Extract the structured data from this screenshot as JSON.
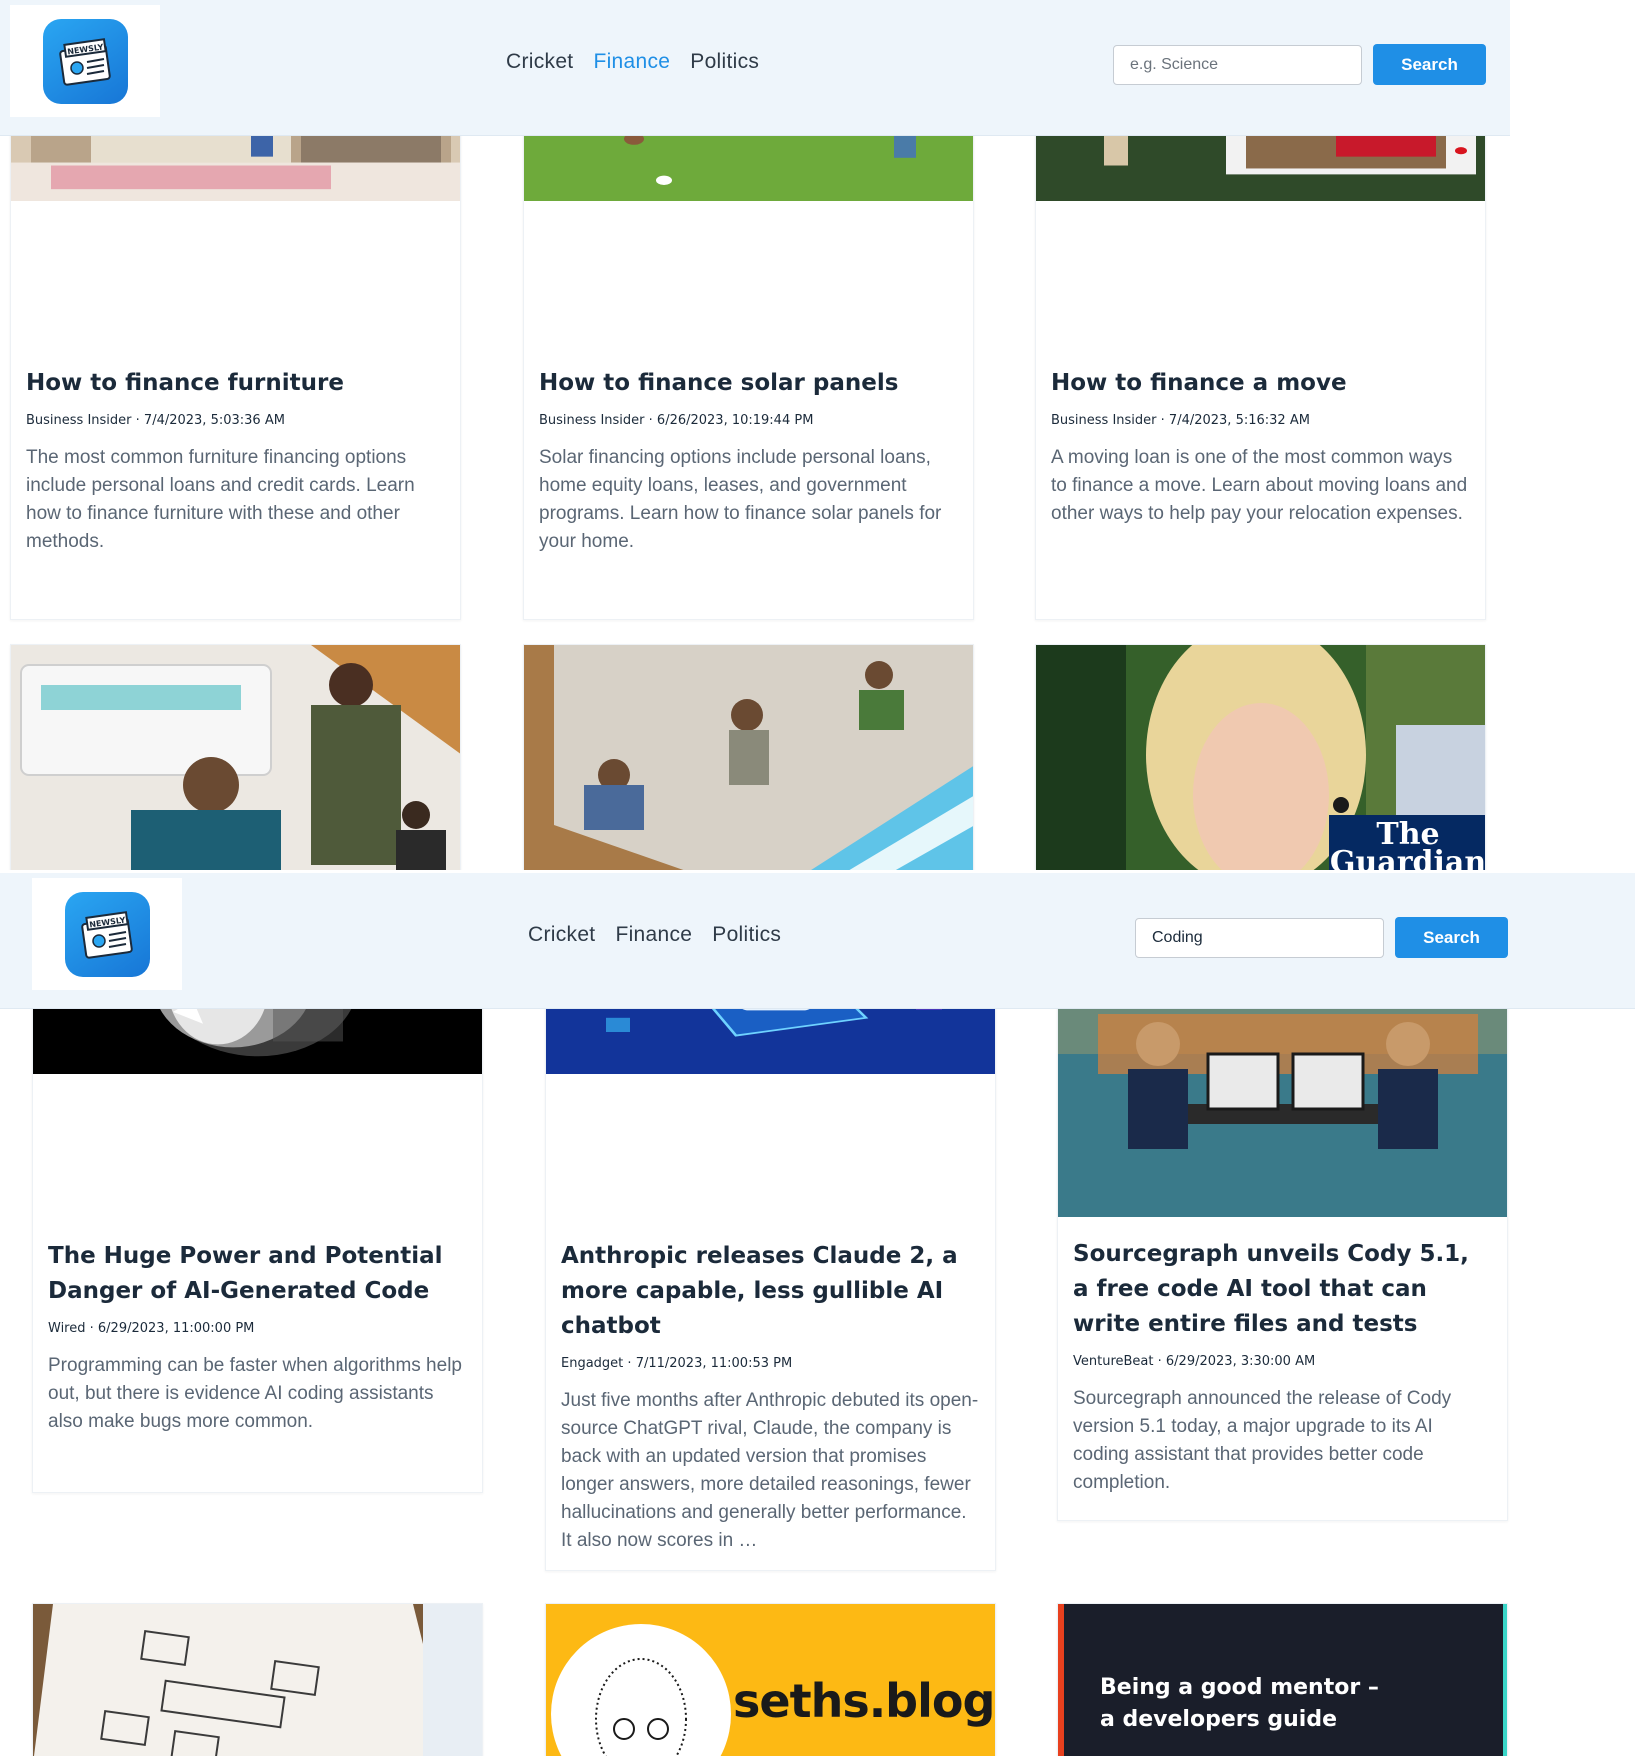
{
  "brand": {
    "logo_text": "NEWSLY"
  },
  "nav": {
    "cricket": "Cricket",
    "finance": "Finance",
    "politics": "Politics"
  },
  "search": {
    "placeholder": "e.g. Science",
    "button_label": "Search"
  },
  "accent_color": "#1f8fe6",
  "view1": {
    "active_tab": "Finance",
    "search_value": "",
    "articles": [
      {
        "title": "How to finance furniture",
        "source": "Business Insider",
        "date": "7/4/2023, 5:03:36 AM",
        "description": "The most common furniture financing options include personal loans and credit cards. Learn how to finance furniture with these and other methods."
      },
      {
        "title": "How to finance solar panels",
        "source": "Business Insider",
        "date": "6/26/2023, 10:19:44 PM",
        "description": "Solar financing options include personal loans, home equity loans, leases, and government programs. Learn how to finance solar panels for your home."
      },
      {
        "title": "How to finance a move",
        "source": "Business Insider",
        "date": "7/4/2023, 5:16:32 AM",
        "description": "A moving loan is one of the most common ways to finance a move. Learn about moving loans and other ways to help pay your relocation expenses."
      }
    ],
    "guardian_logo": "The Guardian"
  },
  "view2": {
    "search_value": "Coding",
    "articles": [
      {
        "title": "The Huge Power and Potential Danger of AI-Generated Code",
        "source": "Wired",
        "date": "6/29/2023, 11:00:00 PM",
        "description": "Programming can be faster when algorithms help out, but there is evidence AI coding assistants also make bugs more common."
      },
      {
        "title": "Anthropic releases Claude 2, a more capable, less gullible AI chatbot",
        "source": "Engadget",
        "date": "7/11/2023, 11:00:53 PM",
        "description": "Just five months after Anthropic debuted its open-source ChatGPT rival, Claude, the company is back with an updated version that promises longer answers, more detailed reasonings, fewer hallucinations and generally better performance. It also now scores in …"
      },
      {
        "title": "Sourcegraph unveils Cody 5.1, a free code AI tool that can write entire files and tests",
        "source": "VentureBeat",
        "date": "6/29/2023, 3:30:00 AM",
        "description": "Sourcegraph announced the release of Cody version 5.1 today, a major upgrade to its AI coding assistant that provides better code completion."
      }
    ],
    "sethsblog_logo": "seths.blog",
    "mentor_image_text": "Being a good mentor – a developers guide"
  }
}
